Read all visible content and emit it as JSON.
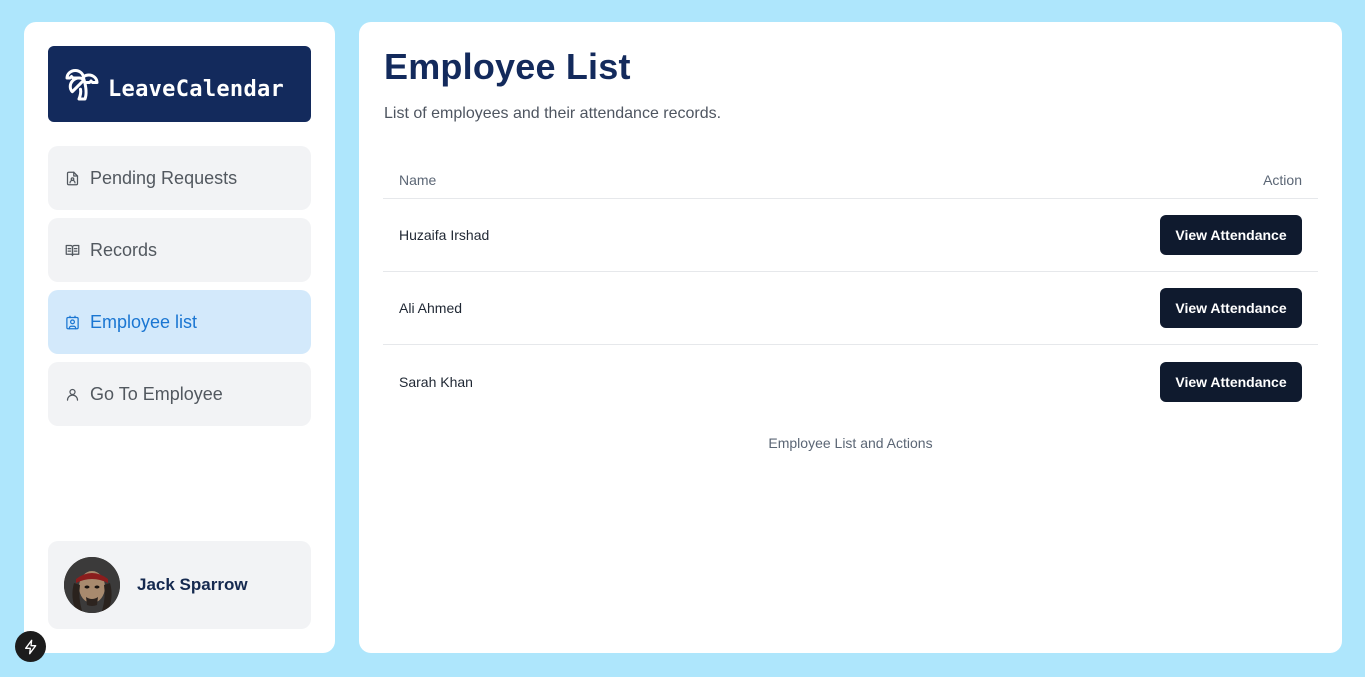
{
  "app": {
    "name": "LeaveCalendar"
  },
  "nav": {
    "items": [
      {
        "label": "Pending Requests",
        "icon": "file-user-icon",
        "active": false
      },
      {
        "label": "Records",
        "icon": "book-open-icon",
        "active": false
      },
      {
        "label": "Employee list",
        "icon": "contact-icon",
        "active": true
      },
      {
        "label": "Go To Employee",
        "icon": "user-icon",
        "active": false
      }
    ]
  },
  "user": {
    "name": "Jack Sparrow"
  },
  "page": {
    "title": "Employee List",
    "subtitle": "List of employees and their attendance records."
  },
  "table": {
    "headers": {
      "name": "Name",
      "action": "Action"
    },
    "rows": [
      {
        "name": "Huzaifa Irshad",
        "action": "View Attendance"
      },
      {
        "name": "Ali Ahmed",
        "action": "View Attendance"
      },
      {
        "name": "Sarah Khan",
        "action": "View Attendance"
      }
    ],
    "caption": "Employee List and Actions"
  },
  "colors": {
    "background": "#aee6fc",
    "brand": "#132a5c",
    "active_bg": "#d3e9fb",
    "active_text": "#1a76d2",
    "button": "#0f1a2e"
  }
}
